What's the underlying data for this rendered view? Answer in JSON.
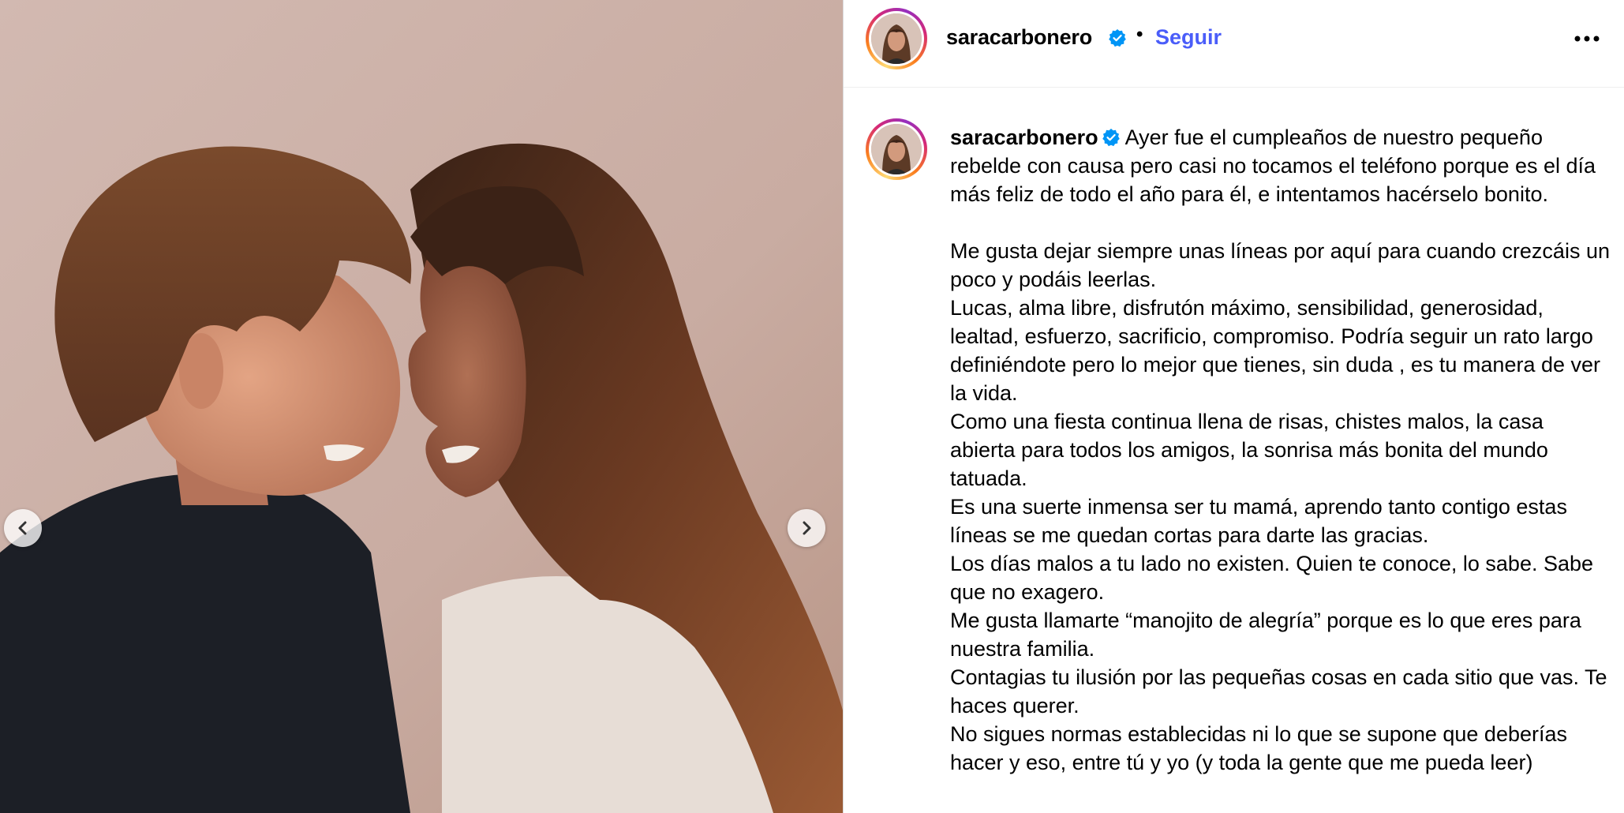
{
  "post": {
    "username": "saracarbonero",
    "separator": "•",
    "follow_label": "Seguir",
    "verified_icon": "verified-badge-icon",
    "more_icon": "more-options-icon"
  },
  "colors": {
    "follow_blue": "#4a5df9",
    "verified_blue": "#0095f6"
  },
  "caption": {
    "username": "saracarbonero",
    "first_line": "Ayer fue el cumpleaños de nuestro pequeño rebelde con causa pero casi no tocamos el teléfono porque es el día más feliz de todo el año para él, e intentamos hacérselo bonito.",
    "paragraphs": [
      "Me gusta dejar siempre unas líneas por aquí para cuando crezcáis un poco y podáis leerlas.",
      "Lucas, alma libre, disfrutón máximo, sensibilidad, generosidad, lealtad, esfuerzo, sacrificio, compromiso. Podría seguir un rato largo definiéndote pero lo mejor que tienes, sin duda , es tu manera de ver la vida.",
      "Como una fiesta continua llena de risas, chistes malos, la casa abierta para todos los amigos, la sonrisa más bonita del mundo tatuada.",
      "Es una suerte inmensa ser tu mamá, aprendo tanto contigo estas líneas se me quedan cortas para darte las gracias.",
      "Los días malos a tu lado no existen. Quien te conoce, lo sabe. Sabe que no exagero.",
      "Me gusta llamarte “manojito de alegría” porque es lo que eres para nuestra familia.",
      "Contagias tu ilusión por las pequeñas cosas en cada sitio que vas. Te haces querer.",
      "No sigues normas establecidas ni lo que se supone que deberías hacer y eso, entre tú y yo (y toda la gente que me pueda leer)"
    ]
  },
  "carousel": {
    "prev_icon": "chevron-left-icon",
    "next_icon": "chevron-right-icon"
  }
}
